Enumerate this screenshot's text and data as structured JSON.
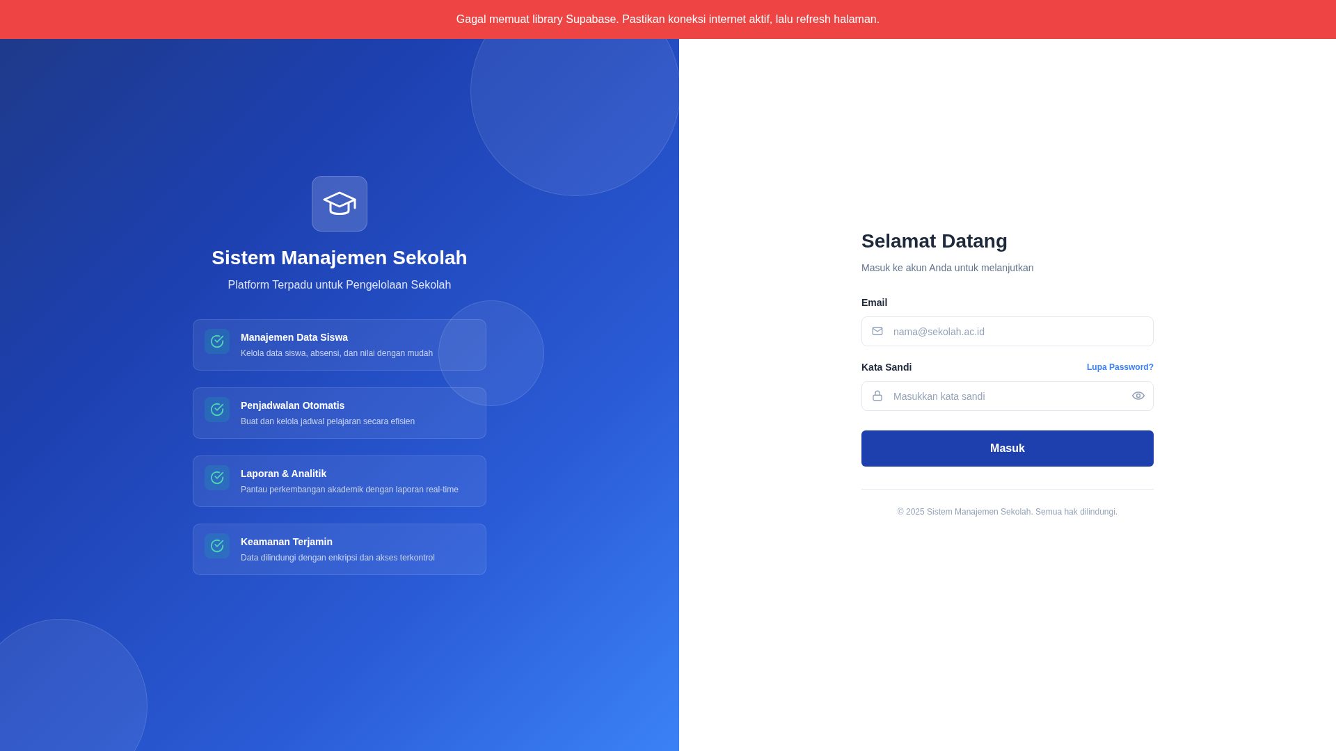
{
  "alert_banner": {
    "message": "Gagal memuat library Supabase. Pastikan koneksi internet aktif, lalu refresh halaman."
  },
  "brand_panel": {
    "title": "Sistem Manajemen Sekolah",
    "subtitle": "Platform Terpadu untuk Pengelolaan Sekolah",
    "features": [
      {
        "title": "Manajemen Data Siswa",
        "description": "Kelola data siswa, absensi, dan nilai dengan mudah"
      },
      {
        "title": "Penjadwalan Otomatis",
        "description": "Buat dan kelola jadwal pelajaran secara efisien"
      },
      {
        "title": "Laporan & Analitik",
        "description": "Pantau perkembangan akademik dengan laporan real-time"
      },
      {
        "title": "Keamanan Terjamin",
        "description": "Data dilindungi dengan enkripsi dan akses terkontrol"
      }
    ]
  },
  "login_form": {
    "title": "Selamat Datang",
    "subtitle": "Masuk ke akun Anda untuk melanjutkan",
    "email": {
      "label": "Email",
      "placeholder": "nama@sekolah.ac.id"
    },
    "password": {
      "label": "Kata Sandi",
      "placeholder": "Masukkan kata sandi",
      "forgot_link": "Lupa Password?"
    },
    "submit_button": "Masuk",
    "footer": "© 2025 Sistem Manajemen Sekolah. Semua hak dilindungi."
  }
}
